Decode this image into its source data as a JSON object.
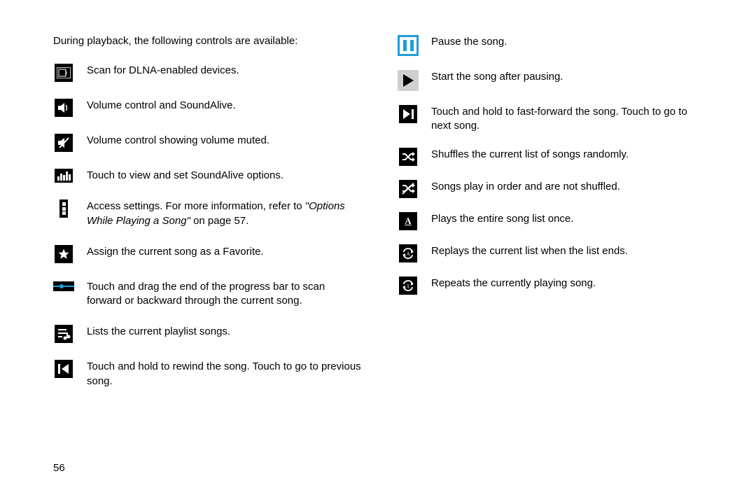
{
  "intro": "During playback, the following controls are available:",
  "pageNumber": "56",
  "left": [
    {
      "text": "Scan for DLNA-enabled devices."
    },
    {
      "text": "Volume control and SoundAlive."
    },
    {
      "text": "Volume control showing volume muted."
    },
    {
      "text": "Touch to view and set SoundAlive options."
    },
    {
      "prefix": "Access settings. For more information, refer to ",
      "italic": "\"Options While Playing a Song\"",
      "suffix": " on page 57."
    },
    {
      "text": "Assign the current song as a Favorite."
    },
    {
      "text": "Touch and drag the end of the progress bar to scan forward or backward through the current song."
    },
    {
      "text": "Lists the current playlist songs."
    },
    {
      "text": "Touch and hold to rewind the song. Touch to go to previous song."
    }
  ],
  "right": [
    {
      "text": "Pause the song."
    },
    {
      "text": "Start the song after pausing."
    },
    {
      "text": "Touch and hold to fast-forward the song. Touch to go to next song."
    },
    {
      "text": "Shuffles the current list of songs randomly."
    },
    {
      "text": "Songs play in order and are not shuffled."
    },
    {
      "text": "Plays the entire song list once."
    },
    {
      "text": "Replays the current list when the list ends."
    },
    {
      "text": "Repeats the currently playing song."
    }
  ]
}
